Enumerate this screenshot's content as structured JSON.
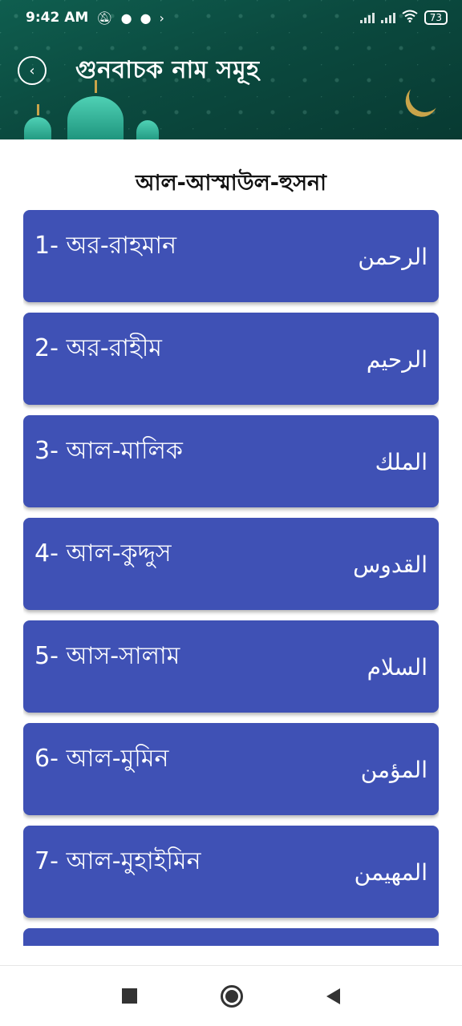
{
  "status_bar": {
    "time": "9:42 AM",
    "battery": "73",
    "left_icons": [
      "bell-off-icon",
      "messenger-icon",
      "chat-icon",
      "arrow-icon"
    ],
    "right_icons": [
      "signal-1-icon",
      "signal-2-icon",
      "wifi-icon",
      "battery-icon"
    ]
  },
  "toolbar": {
    "title": "গুনবাচক নাম সমূহ",
    "back_icon": "chevron-left-icon"
  },
  "subtitle": "আল-আস্মাউল-হুসনা",
  "names": [
    {
      "bn": "1- অর-রাহমান",
      "ar": "الرحمن"
    },
    {
      "bn": "2- অর-রাহীম",
      "ar": "الرحيم"
    },
    {
      "bn": "3- আল-মালিক",
      "ar": "الملك"
    },
    {
      "bn": "4- আল-কুদ্দুস",
      "ar": "القدوس"
    },
    {
      "bn": "5- আস-সালাম",
      "ar": "السلام"
    },
    {
      "bn": "6- আল-মুমিন",
      "ar": "المؤمن"
    },
    {
      "bn": "7- আল-মুহাইমিন",
      "ar": "المهيمن"
    },
    {
      "bn": "",
      "ar": ""
    }
  ],
  "colors": {
    "card": "#3f51b5",
    "header": "#0f5e4f"
  },
  "nav_bar": {
    "icons": [
      "recents-square-icon",
      "home-circle-icon",
      "back-triangle-icon"
    ]
  }
}
